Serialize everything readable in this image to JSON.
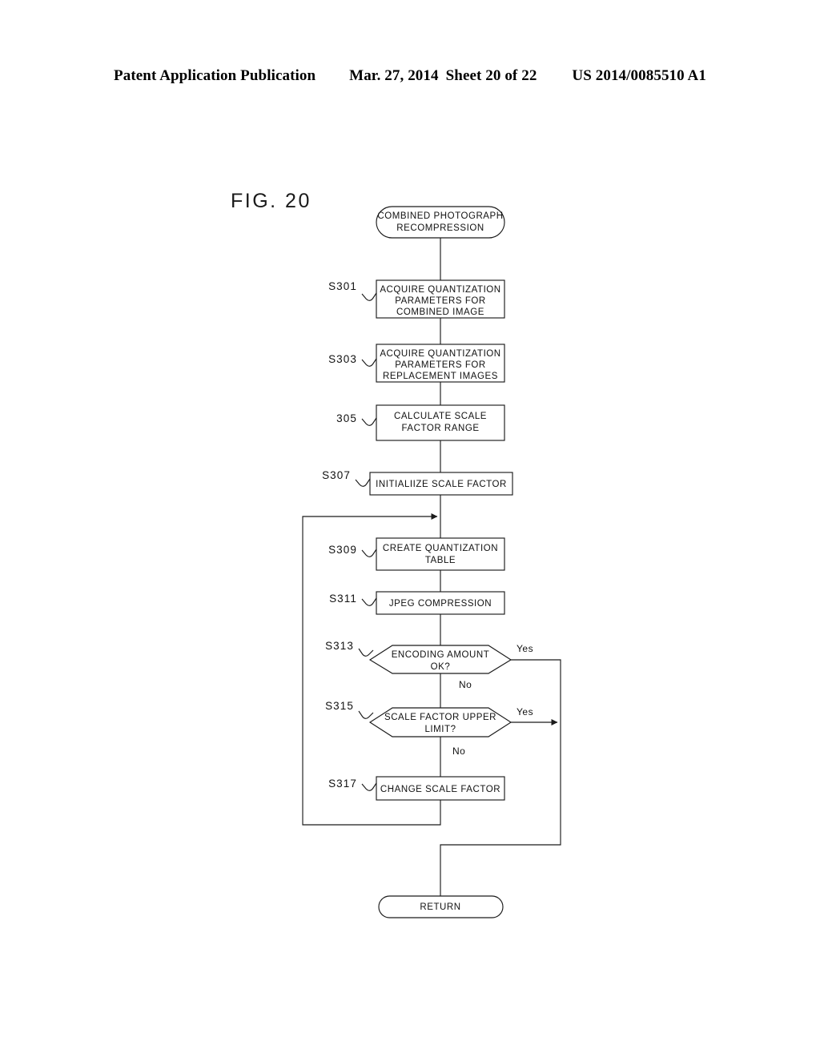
{
  "header": {
    "publication": "Patent Application Publication",
    "date": "Mar. 27, 2014",
    "sheet": "Sheet 20 of 22",
    "patent_number": "US 2014/0085510 A1"
  },
  "figure": {
    "title": "FIG. 20",
    "nodes": {
      "start": {
        "step": "",
        "line1": "COMBINED PHOTOGRAPH",
        "line2": "RECOMPRESSION"
      },
      "s301": {
        "step": "S301",
        "line1": "ACQUIRE QUANTIZATION",
        "line2": "PARAMETERS FOR",
        "line3": "COMBINED IMAGE"
      },
      "s303": {
        "step": "S303",
        "line1": "ACQUIRE QUANTIZATION",
        "line2": "PARAMETERS FOR",
        "line3": "REPLACEMENT IMAGES"
      },
      "s305": {
        "step": "305",
        "line1": "CALCULATE SCALE",
        "line2": "FACTOR RANGE"
      },
      "s307": {
        "step": "S307",
        "line1": "INITIALIIZE SCALE FACTOR"
      },
      "s309": {
        "step": "S309",
        "line1": "CREATE QUANTIZATION",
        "line2": "TABLE"
      },
      "s311": {
        "step": "S311",
        "line1": "JPEG COMPRESSION"
      },
      "s313": {
        "step": "S313",
        "line1": "ENCODING AMOUNT",
        "line2": "OK?"
      },
      "s315": {
        "step": "S315",
        "line1": "SCALE FACTOR UPPER",
        "line2": "LIMIT?"
      },
      "s317": {
        "step": "S317",
        "line1": "CHANGE SCALE FACTOR"
      },
      "return": {
        "step": "",
        "line1": "RETURN"
      }
    },
    "branches": {
      "s313_yes": "Yes",
      "s313_no": "No",
      "s315_yes": "Yes",
      "s315_no": "No"
    }
  }
}
